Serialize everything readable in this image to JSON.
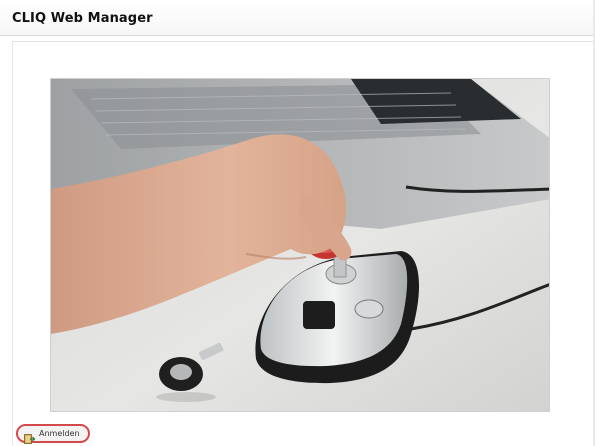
{
  "window": {
    "title": "CLIQ Web Manager"
  },
  "photo": {
    "alt": ""
  },
  "login_button": {
    "label": "Anmelden",
    "icon": "login-icon"
  }
}
